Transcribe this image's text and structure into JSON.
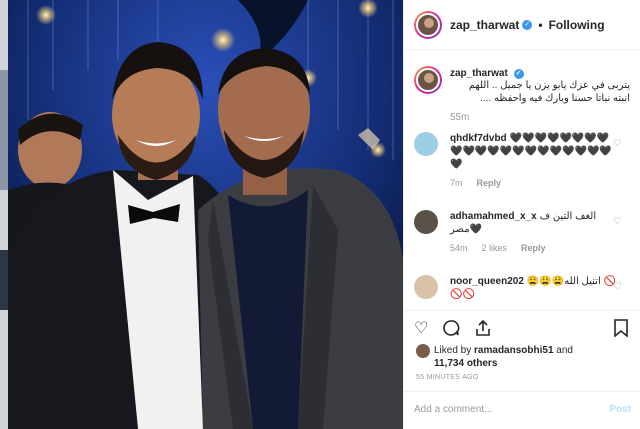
{
  "post": {
    "username": "zap_tharwat",
    "verified_mark": "✓",
    "separator": "•",
    "follow_state": "Following",
    "caption_user": "zap_tharwat",
    "caption_text": "يتربى في عزك يابو يزن يا جميل .. اللهم انبته نباتا حسنا وبارك فيه واحفظه ....",
    "caption_time": "55m"
  },
  "comments": [
    {
      "user": "qhdkf7dvbd",
      "text": "🖤🖤🖤🖤🖤🖤🖤🖤🖤🖤🖤🖤🖤🖤🖤🖤🖤🖤🖤🖤🖤🖤",
      "time": "7m",
      "likes": "",
      "reply": "Reply"
    },
    {
      "user": "adhamahmed_x_x",
      "text": "الغف التين ف مصر🖤",
      "time": "54m",
      "likes": "2 likes",
      "reply": "Reply"
    },
    {
      "user": "noor_queen202",
      "text": "😩😩😩اتنيل الله 🚫🚫🚫",
      "time": "",
      "likes": "",
      "reply": ""
    }
  ],
  "actions": {
    "heart_icon": "heart-icon",
    "comment_icon": "comment-icon",
    "share_icon": "share-icon",
    "bookmark_icon": "bookmark-icon"
  },
  "likes": {
    "prefix": "Liked by",
    "user": "ramadansobhi51",
    "and": "and",
    "others": "11,734 others"
  },
  "timestamp": "55 MINUTES AGO",
  "add_comment": {
    "placeholder": "Add a comment...",
    "post_label": "Post"
  },
  "colors": {
    "verified": "#3897f0",
    "post_disabled": "#b2dffc",
    "muted": "#999999"
  }
}
